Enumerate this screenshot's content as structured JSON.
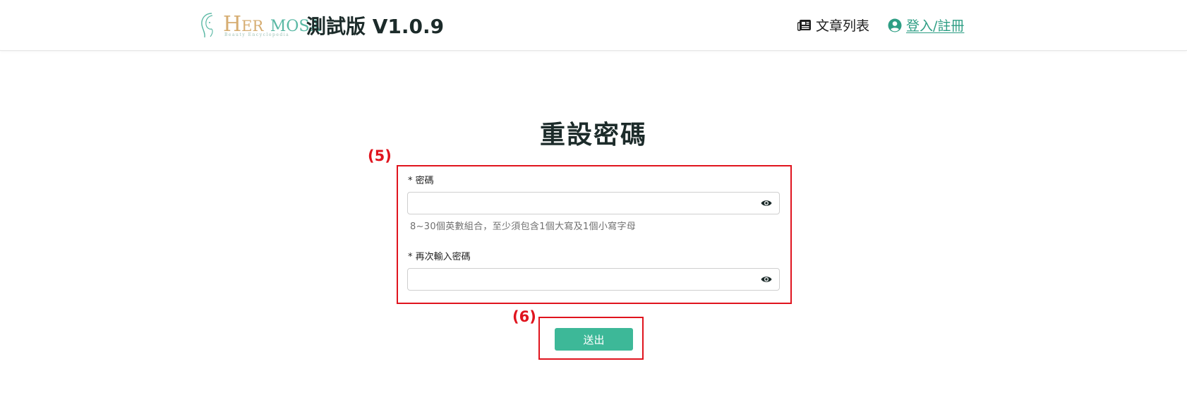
{
  "header": {
    "logo_text_h": "H",
    "logo_text_er": "ER",
    "logo_text_mosa": "MOSA",
    "logo_subtitle": "Beauty Encyclopedia",
    "version_label": "測試版 V1.0.9",
    "nav_articles": "文章列表",
    "nav_login": "登入/註冊"
  },
  "page": {
    "title": "重設密碼"
  },
  "form": {
    "password_label": "* 密碼",
    "password_value": "",
    "password_hint": "8~30個英數組合，至少須包含1個大寫及1個小寫字母",
    "confirm_label": "* 再次輸入密碼",
    "confirm_value": "",
    "submit_label": "送出"
  },
  "annotations": {
    "form_marker": "(5)",
    "submit_marker": "(6)"
  },
  "colors": {
    "brand_green": "#3db898",
    "link_green": "#2e9e84",
    "logo_gold": "#d6ad72",
    "annotation_red": "#e0141e"
  },
  "icons": {
    "articles": "newspaper-icon",
    "account": "user-circle-icon",
    "toggle_visibility": "eye-icon"
  }
}
